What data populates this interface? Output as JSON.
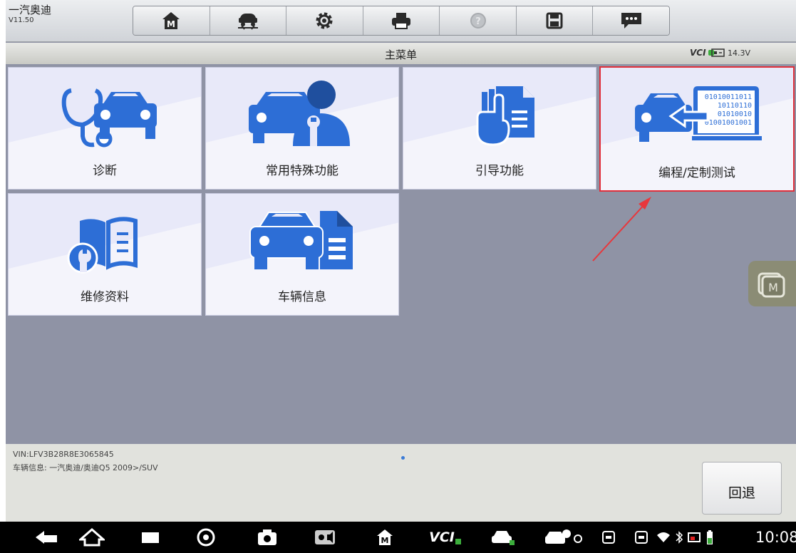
{
  "app": {
    "name": "一汽奥迪",
    "version": "V11.50"
  },
  "toolbar": {
    "buttons": [
      {
        "name": "home-m-icon"
      },
      {
        "name": "car-lift-icon"
      },
      {
        "name": "gear-icon"
      },
      {
        "name": "printer-icon"
      },
      {
        "name": "help-icon"
      },
      {
        "name": "save-icon"
      },
      {
        "name": "message-icon"
      }
    ]
  },
  "header": {
    "title": "主菜单",
    "vci": "VCI",
    "voltage": "14.3V"
  },
  "menu": {
    "items": [
      {
        "label": "诊断",
        "icon": "stethoscope-car-icon"
      },
      {
        "label": "常用特殊功能",
        "icon": "car-mechanic-icon"
      },
      {
        "label": "引导功能",
        "icon": "guided-hand-document-icon"
      },
      {
        "label": "编程/定制测试",
        "icon": "car-binary-programming-icon",
        "selected": true
      },
      {
        "label": "维修资料",
        "icon": "wrench-book-icon"
      },
      {
        "label": "车辆信息",
        "icon": "car-document-icon"
      }
    ],
    "binary_lines": [
      "01010011011",
      "10110110",
      "01010010",
      "01001001001"
    ]
  },
  "float_button": {
    "label": "M"
  },
  "footer": {
    "vin": "VIN:LFV3B28R8E3065845",
    "vehicle": "车辆信息: 一汽奥迪/奥迪Q5 2009>/SUV",
    "back_label": "回退"
  },
  "system_bar": {
    "vci": "VCI",
    "time": "10:08"
  },
  "colors": {
    "accent_blue": "#2d6ed6",
    "selected_border": "#e0303c",
    "annotation_arrow": "#e8373c"
  }
}
